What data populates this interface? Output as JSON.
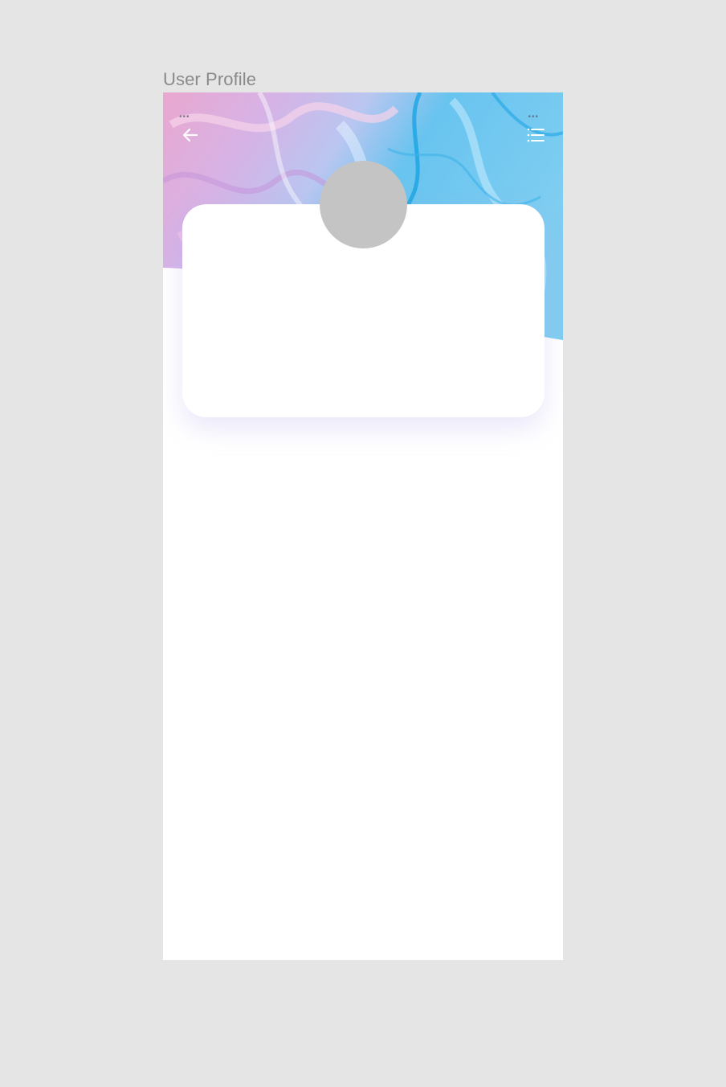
{
  "frame": {
    "label": "User Profile"
  },
  "status_bar": {
    "left_dots": "•••",
    "right_dots": "•••"
  },
  "header": {
    "back_icon": "arrow-left-icon",
    "menu_icon": "list-menu-icon",
    "icon_color": "#ffffff"
  },
  "profile": {
    "avatar_color": "#c4c4c4",
    "card_color": "#ffffff"
  },
  "colors": {
    "canvas": "#e5e5e5",
    "screen": "#ffffff",
    "header_pink": "#e8a8d0",
    "header_blue": "#5fc0ee"
  }
}
